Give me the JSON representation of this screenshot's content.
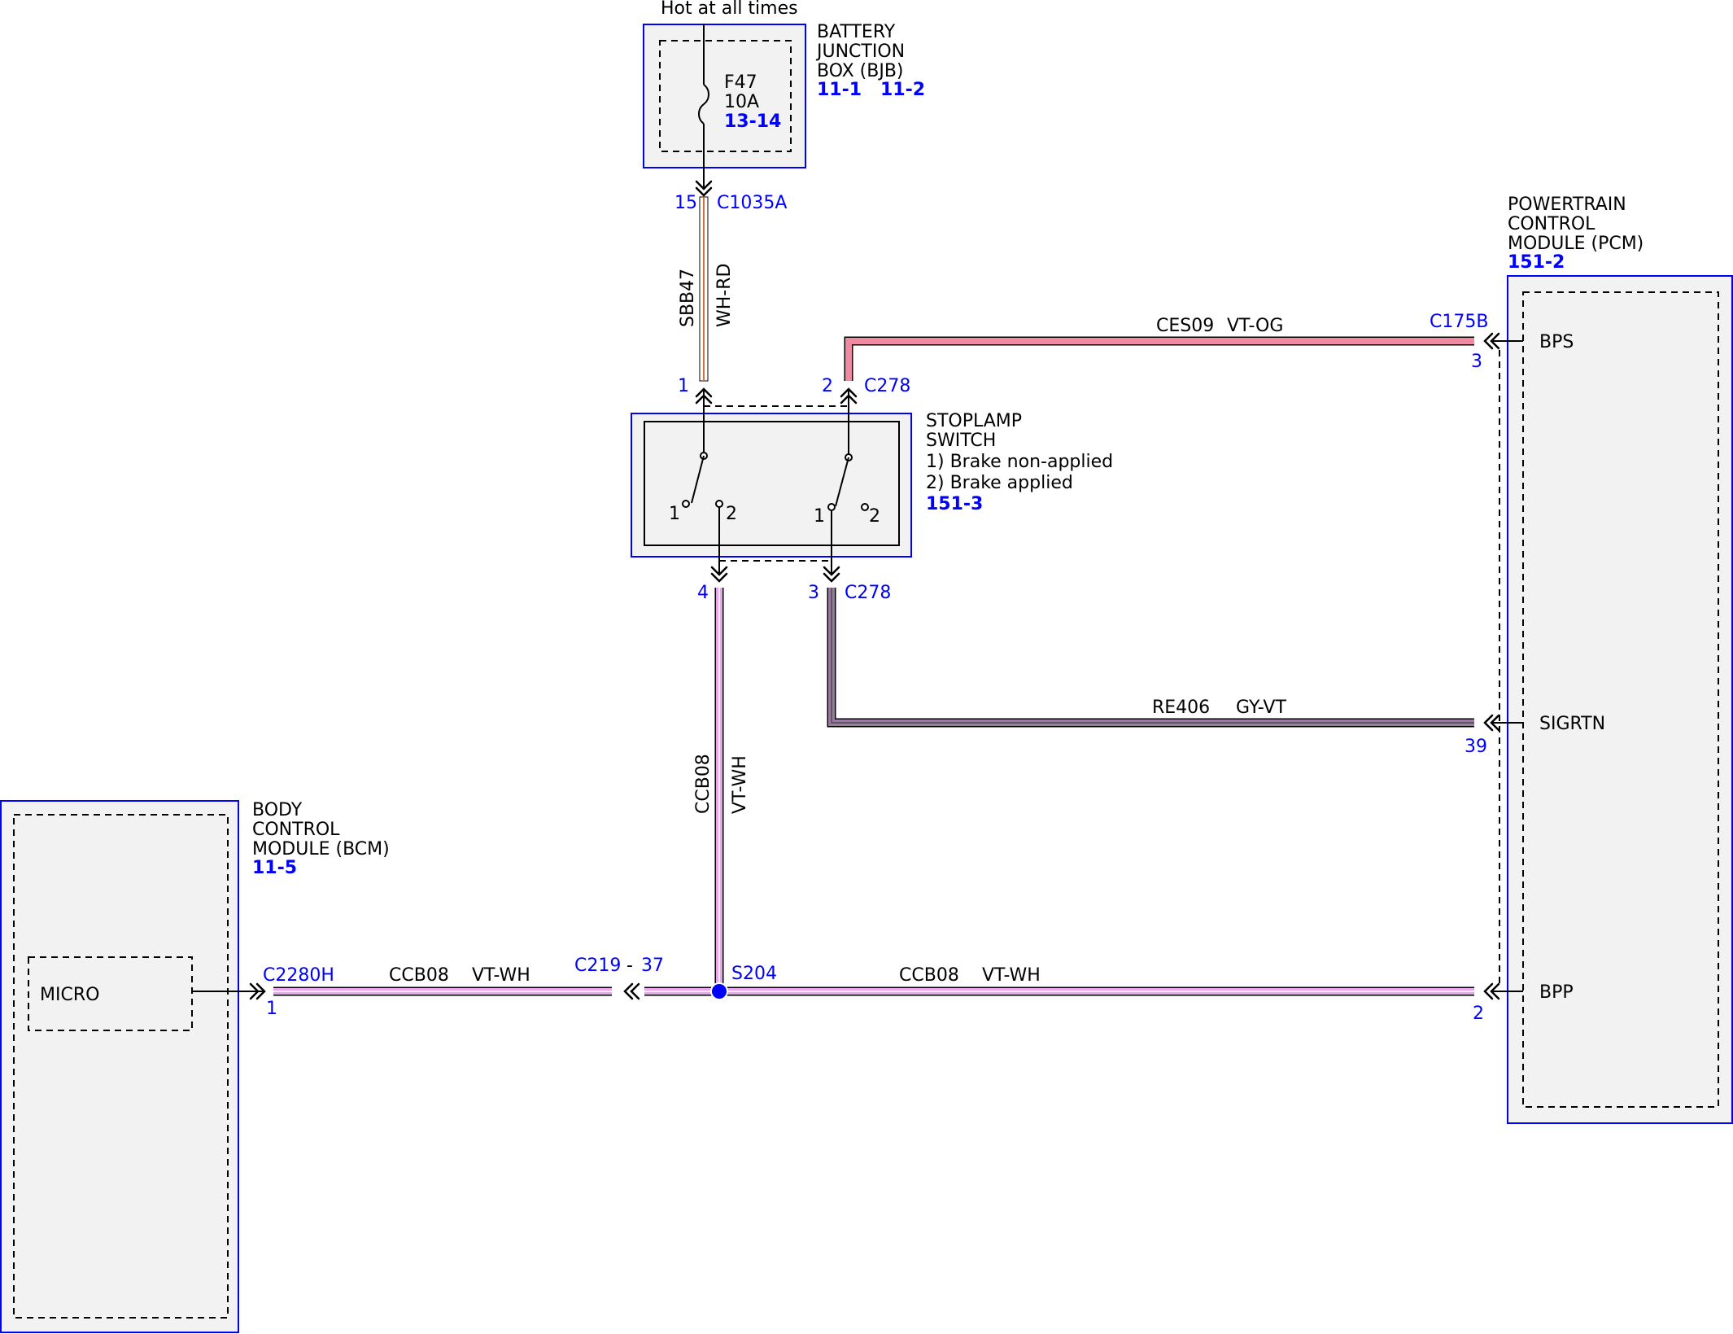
{
  "colors": {
    "component_outline": "#0000ff",
    "component_fill": "#f2f2f2",
    "wire_VT-WH": "#e9a6ee",
    "wire_VT-OG": "#ef8aa0",
    "wire_WH-RD": "#e06a30",
    "wire_GY-VT": "#9a7aa3",
    "splice_dot": "#0000ff"
  },
  "power": {
    "label": "Hot at all times"
  },
  "bjb": {
    "title_lines": [
      "BATTERY",
      "JUNCTION",
      "BOX (BJB)"
    ],
    "refs": [
      "11-1",
      "11-2"
    ],
    "fuse": {
      "name": "F47",
      "rating": "10A",
      "ref": "13-14"
    },
    "connector": {
      "pin": "15",
      "name": "C1035A"
    }
  },
  "wire_sbb47": {
    "circuit": "SBB47",
    "color": "WH-RD"
  },
  "stoplamp_switch": {
    "title_lines": [
      "STOPLAMP",
      "SWITCH",
      "1) Brake non-applied",
      "2) Brake applied"
    ],
    "ref": "151-3",
    "connector_top": {
      "pin_left": "1",
      "pin_right": "2",
      "name": "C278"
    },
    "connector_bottom": {
      "pin_left": "4",
      "pin_right": "3",
      "name": "C278"
    },
    "contacts": [
      "1",
      "2",
      "1",
      "2"
    ]
  },
  "wire_ces09": {
    "circuit": "CES09",
    "color": "VT-OG",
    "connector": "C175B",
    "pin": "3"
  },
  "wire_re406": {
    "circuit": "RE406",
    "color": "GY-VT",
    "pin": "39"
  },
  "wire_ccb08_vertical": {
    "circuit": "CCB08",
    "color": "VT-WH"
  },
  "wire_ccb08_left": {
    "circuit": "CCB08",
    "color": "VT-WH",
    "connector": "C2280H",
    "pin": "1"
  },
  "inline_connector": {
    "name": "C219",
    "separator": "-",
    "pin": "37"
  },
  "splice": {
    "name": "S204"
  },
  "wire_ccb08_right": {
    "circuit": "CCB08",
    "color": "VT-WH",
    "pin": "2"
  },
  "pcm": {
    "title_lines": [
      "POWERTRAIN",
      "CONTROL",
      "MODULE (PCM)"
    ],
    "ref": "151-2",
    "pins": [
      "BPS",
      "SIGRTN",
      "BPP"
    ]
  },
  "bcm": {
    "title_lines": [
      "BODY",
      "CONTROL",
      "MODULE (BCM)"
    ],
    "ref": "11-5",
    "inner": "MICRO"
  }
}
